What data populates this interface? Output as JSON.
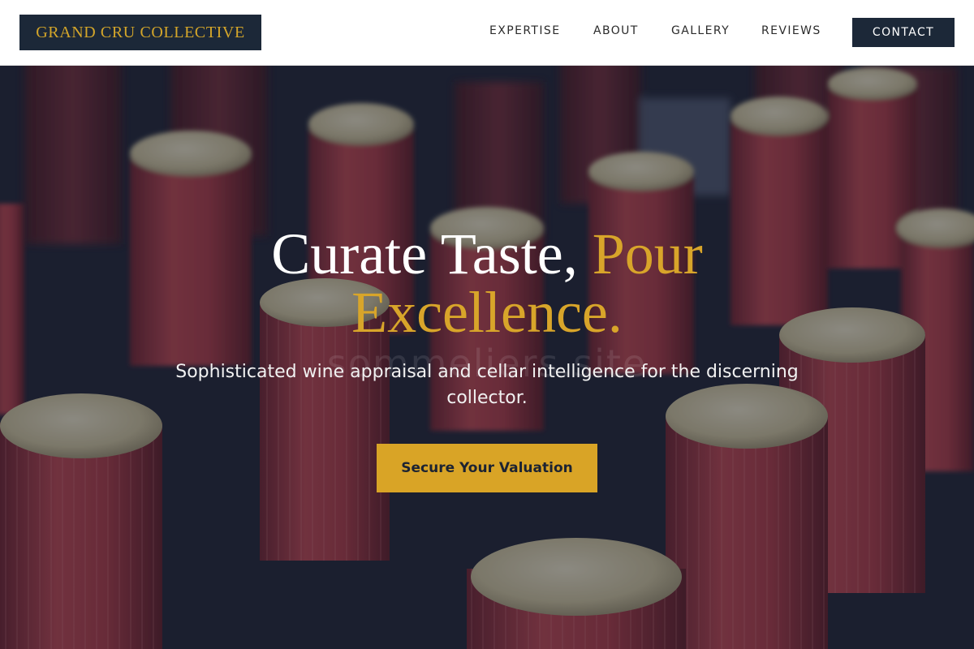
{
  "header": {
    "brand": "GRAND CRU COLLECTIVE",
    "nav": {
      "expertise": "EXPERTISE",
      "about": "ABOUT",
      "gallery": "GALLERY",
      "reviews": "REVIEWS"
    },
    "contact_label": "CONTACT"
  },
  "hero": {
    "title_white": "Curate Taste, ",
    "title_accent": "Pour Excellence.",
    "subtitle": "Sophisticated wine appraisal and cellar intelligence for the discerning collector.",
    "watermark": "sommeliers.site",
    "cta_label": "Secure Your Valuation",
    "background_subject": "wine-bottles-capsules-photo"
  },
  "colors": {
    "navy": "#1c2838",
    "gold": "#d8a52a",
    "capsule_red": "#a33a45",
    "white": "#ffffff"
  }
}
